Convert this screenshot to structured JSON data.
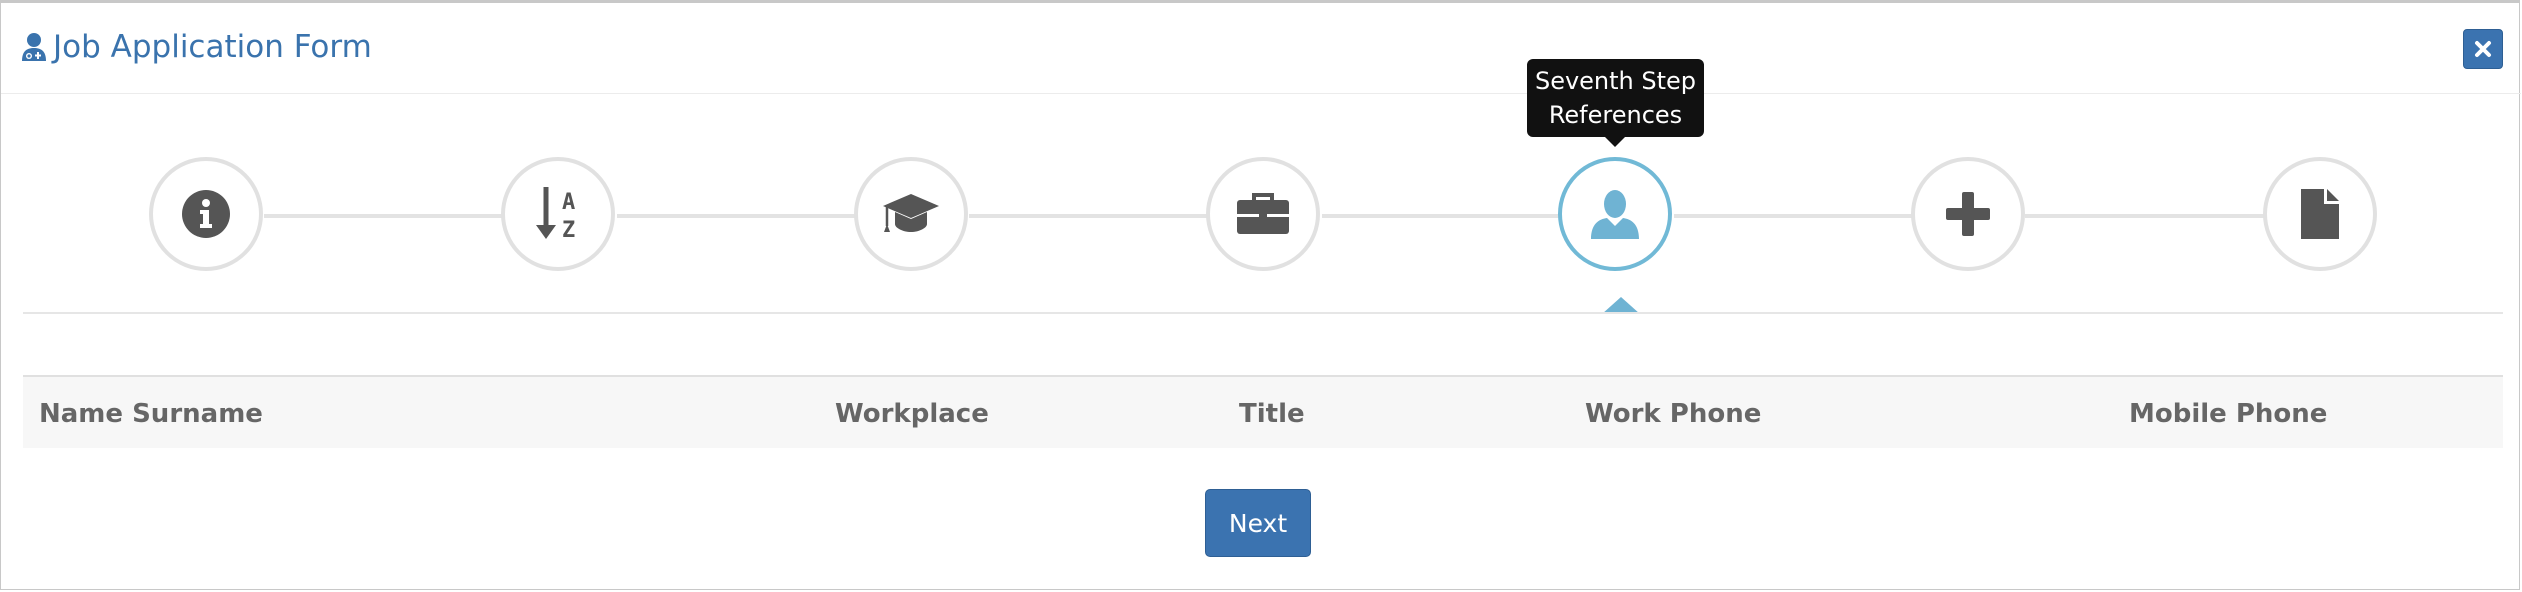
{
  "dialog": {
    "title": "Job Application Form",
    "close_icon": "close-icon",
    "title_icon": "user-doctor-icon"
  },
  "stepper": {
    "steps": [
      {
        "icon": "info-circle-icon",
        "state": "inactive"
      },
      {
        "icon": "sort-alpha-down-icon",
        "state": "inactive"
      },
      {
        "icon": "graduation-cap-icon",
        "state": "inactive"
      },
      {
        "icon": "briefcase-icon",
        "state": "inactive"
      },
      {
        "icon": "user-icon",
        "state": "active"
      },
      {
        "icon": "plus-icon",
        "state": "inactive"
      },
      {
        "icon": "file-icon",
        "state": "inactive"
      }
    ],
    "tooltip": {
      "line1": "Seventh Step",
      "line2": "References"
    }
  },
  "table": {
    "columns": [
      "Name Surname",
      "Workplace",
      "Title",
      "Work Phone",
      "Mobile Phone"
    ]
  },
  "actions": {
    "next_label": "Next"
  },
  "colors": {
    "primary": "#3b73b0",
    "active_step": "#71b9d6",
    "icon": "#555555"
  }
}
